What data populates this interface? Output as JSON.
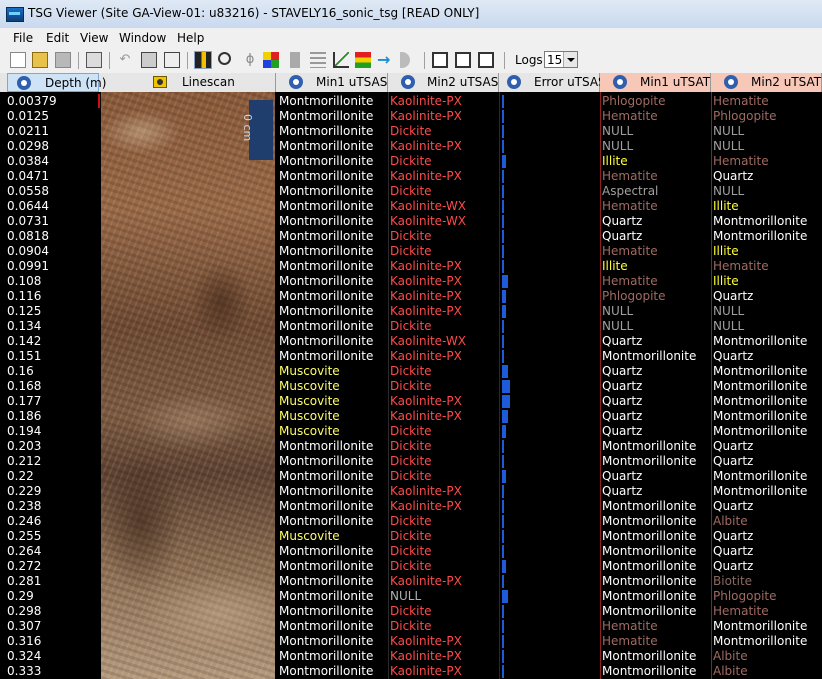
{
  "window": {
    "title": "TSG Viewer (Site GA-View-01: u83216)  - STAVELY16_sonic_tsg [READ ONLY]"
  },
  "menu": [
    "File",
    "Edit",
    "View",
    "Window",
    "Help"
  ],
  "toolbar": {
    "icons": [
      "new-icon",
      "open-icon",
      "save-icon",
      "print-icon",
      "undo-icon",
      "copy-icon",
      "paste-icon",
      "layout-icon",
      "zoom-icon",
      "lasso-icon",
      "color-icon",
      "column-icon",
      "grid-icon",
      "chart-icon",
      "legend-icon",
      "arrow-right-icon",
      "half-circle-icon",
      "window1-icon",
      "window2-icon",
      "window3-icon"
    ],
    "logs_label": "Logs:",
    "logs_value": "15"
  },
  "columns": {
    "depth": "Depth (m)",
    "linescan": "Linescan",
    "min1_utsas": "Min1 uTSAS",
    "min2_utsas": "Min2 uTSAS",
    "error_utsas": "Error uTSAS",
    "min1_utsat": "Min1 uTSAT",
    "min2_utsat": "Min2 uTSAT"
  },
  "linescan_tag": "0 cm",
  "colors": {
    "header_blue": "#cfe3f7",
    "header_salmon": "#f7c7b8",
    "montmorillonite": "#ffffff",
    "muscovite": "#ffff66",
    "kaolinite": "#ff4a4a",
    "dickite": "#ff4a4a",
    "null_min2": "#b0b0b0",
    "illite": "#ffff33",
    "hematite": "#a06b62",
    "quartz": "#ffffff",
    "null_utsat": "#a0a0a0",
    "phlogopite": "#a06b62",
    "albite": "#a06b62",
    "biotite": "#8a6a60",
    "aspectral": "#a0a0a0",
    "error_bar": "#1e5bd8"
  },
  "rows": [
    {
      "depth": "0.00379",
      "min1": "Montmorillonite",
      "min2": "Kaolinite-PX",
      "err": 0.1,
      "t1": "Phlogopite",
      "t2": "Hematite"
    },
    {
      "depth": "0.0125",
      "min1": "Montmorillonite",
      "min2": "Kaolinite-PX",
      "err": 0.05,
      "t1": "Hematite",
      "t2": "Phlogopite"
    },
    {
      "depth": "0.0211",
      "min1": "Montmorillonite",
      "min2": "Dickite",
      "err": 0.05,
      "t1": "NULL",
      "t2": "NULL"
    },
    {
      "depth": "0.0298",
      "min1": "Montmorillonite",
      "min2": "Kaolinite-PX",
      "err": 0.05,
      "t1": "NULL",
      "t2": "NULL"
    },
    {
      "depth": "0.0384",
      "min1": "Montmorillonite",
      "min2": "Dickite",
      "err": 0.2,
      "t1": "Illite",
      "t2": "Hematite"
    },
    {
      "depth": "0.0471",
      "min1": "Montmorillonite",
      "min2": "Kaolinite-PX",
      "err": 0.1,
      "t1": "Hematite",
      "t2": "Quartz"
    },
    {
      "depth": "0.0558",
      "min1": "Montmorillonite",
      "min2": "Dickite",
      "err": 0.05,
      "t1": "Aspectral",
      "t2": "NULL"
    },
    {
      "depth": "0.0644",
      "min1": "Montmorillonite",
      "min2": "Kaolinite-WX",
      "err": 0.1,
      "t1": "Hematite",
      "t2": "Illite"
    },
    {
      "depth": "0.0731",
      "min1": "Montmorillonite",
      "min2": "Kaolinite-WX",
      "err": 0.05,
      "t1": "Quartz",
      "t2": "Montmorillonite"
    },
    {
      "depth": "0.0818",
      "min1": "Montmorillonite",
      "min2": "Dickite",
      "err": 0.1,
      "t1": "Quartz",
      "t2": "Montmorillonite"
    },
    {
      "depth": "0.0904",
      "min1": "Montmorillonite",
      "min2": "Dickite",
      "err": 0.1,
      "t1": "Hematite",
      "t2": "Illite"
    },
    {
      "depth": "0.0991",
      "min1": "Montmorillonite",
      "min2": "Kaolinite-PX",
      "err": 0.1,
      "t1": "Illite",
      "t2": "Hematite"
    },
    {
      "depth": "0.108",
      "min1": "Montmorillonite",
      "min2": "Kaolinite-PX",
      "err": 0.3,
      "t1": "Hematite",
      "t2": "Illite"
    },
    {
      "depth": "0.116",
      "min1": "Montmorillonite",
      "min2": "Kaolinite-PX",
      "err": 0.2,
      "t1": "Phlogopite",
      "t2": "Quartz"
    },
    {
      "depth": "0.125",
      "min1": "Montmorillonite",
      "min2": "Kaolinite-PX",
      "err": 0.2,
      "t1": "NULL",
      "t2": "NULL"
    },
    {
      "depth": "0.134",
      "min1": "Montmorillonite",
      "min2": "Dickite",
      "err": 0.1,
      "t1": "NULL",
      "t2": "NULL"
    },
    {
      "depth": "0.142",
      "min1": "Montmorillonite",
      "min2": "Kaolinite-WX",
      "err": 0.1,
      "t1": "Quartz",
      "t2": "Montmorillonite"
    },
    {
      "depth": "0.151",
      "min1": "Montmorillonite",
      "min2": "Kaolinite-PX",
      "err": 0.1,
      "t1": "Montmorillonite",
      "t2": "Quartz"
    },
    {
      "depth": "0.16",
      "min1": "Muscovite",
      "min2": "Dickite",
      "err": 0.3,
      "t1": "Quartz",
      "t2": "Montmorillonite"
    },
    {
      "depth": "0.168",
      "min1": "Muscovite",
      "min2": "Dickite",
      "err": 0.4,
      "t1": "Quartz",
      "t2": "Montmorillonite"
    },
    {
      "depth": "0.177",
      "min1": "Muscovite",
      "min2": "Kaolinite-PX",
      "err": 0.4,
      "t1": "Quartz",
      "t2": "Montmorillonite"
    },
    {
      "depth": "0.186",
      "min1": "Muscovite",
      "min2": "Kaolinite-PX",
      "err": 0.3,
      "t1": "Quartz",
      "t2": "Montmorillonite"
    },
    {
      "depth": "0.194",
      "min1": "Muscovite",
      "min2": "Dickite",
      "err": 0.2,
      "t1": "Quartz",
      "t2": "Montmorillonite"
    },
    {
      "depth": "0.203",
      "min1": "Montmorillonite",
      "min2": "Dickite",
      "err": 0.1,
      "t1": "Montmorillonite",
      "t2": "Quartz"
    },
    {
      "depth": "0.212",
      "min1": "Montmorillonite",
      "min2": "Dickite",
      "err": 0.1,
      "t1": "Montmorillonite",
      "t2": "Quartz"
    },
    {
      "depth": "0.22",
      "min1": "Montmorillonite",
      "min2": "Dickite",
      "err": 0.2,
      "t1": "Quartz",
      "t2": "Montmorillonite"
    },
    {
      "depth": "0.229",
      "min1": "Montmorillonite",
      "min2": "Kaolinite-PX",
      "err": 0.1,
      "t1": "Quartz",
      "t2": "Montmorillonite"
    },
    {
      "depth": "0.238",
      "min1": "Montmorillonite",
      "min2": "Kaolinite-PX",
      "err": 0.1,
      "t1": "Montmorillonite",
      "t2": "Quartz"
    },
    {
      "depth": "0.246",
      "min1": "Montmorillonite",
      "min2": "Dickite",
      "err": 0.1,
      "t1": "Montmorillonite",
      "t2": "Albite"
    },
    {
      "depth": "0.255",
      "min1": "Muscovite",
      "min2": "Dickite",
      "err": 0.1,
      "t1": "Montmorillonite",
      "t2": "Quartz"
    },
    {
      "depth": "0.264",
      "min1": "Montmorillonite",
      "min2": "Dickite",
      "err": 0.1,
      "t1": "Montmorillonite",
      "t2": "Quartz"
    },
    {
      "depth": "0.272",
      "min1": "Montmorillonite",
      "min2": "Dickite",
      "err": 0.2,
      "t1": "Montmorillonite",
      "t2": "Quartz"
    },
    {
      "depth": "0.281",
      "min1": "Montmorillonite",
      "min2": "Kaolinite-PX",
      "err": 0.1,
      "t1": "Montmorillonite",
      "t2": "Biotite"
    },
    {
      "depth": "0.29",
      "min1": "Montmorillonite",
      "min2": "NULL",
      "err": 0.3,
      "t1": "Montmorillonite",
      "t2": "Phlogopite"
    },
    {
      "depth": "0.298",
      "min1": "Montmorillonite",
      "min2": "Dickite",
      "err": 0.1,
      "t1": "Montmorillonite",
      "t2": "Hematite"
    },
    {
      "depth": "0.307",
      "min1": "Montmorillonite",
      "min2": "Dickite",
      "err": 0.1,
      "t1": "Hematite",
      "t2": "Montmorillonite"
    },
    {
      "depth": "0.316",
      "min1": "Montmorillonite",
      "min2": "Kaolinite-PX",
      "err": 0.1,
      "t1": "Hematite",
      "t2": "Montmorillonite"
    },
    {
      "depth": "0.324",
      "min1": "Montmorillonite",
      "min2": "Kaolinite-PX",
      "err": 0.1,
      "t1": "Montmorillonite",
      "t2": "Albite"
    },
    {
      "depth": "0.333",
      "min1": "Montmorillonite",
      "min2": "Kaolinite-PX",
      "err": 0.1,
      "t1": "Montmorillonite",
      "t2": "Albite"
    }
  ]
}
